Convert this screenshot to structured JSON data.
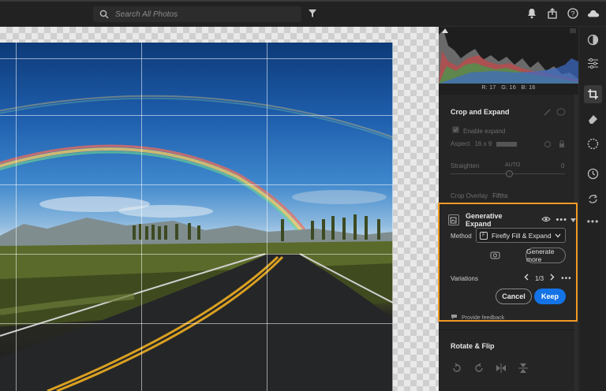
{
  "search": {
    "placeholder": "Search All Photos"
  },
  "histogram": {
    "r_label": "R:",
    "r_value": "17",
    "g_label": "G:",
    "g_value": "16",
    "b_label": "B:",
    "b_value": "16"
  },
  "crop": {
    "title": "Crop and Expand",
    "enable_label": "Enable expand",
    "aspect_label": "Aspect",
    "aspect_value": "16 x 9",
    "straighten_label": "Straighten",
    "straighten_auto": "AUTO",
    "straighten_value": "0",
    "overlay_label": "Crop Overlay",
    "overlay_value": "Fifths"
  },
  "generative_expand": {
    "title": "Generative Expand",
    "method_label": "Method",
    "method_value": "Firefly Fill & Expand",
    "generate_more": "Generate more",
    "variations_label": "Variations",
    "variations_value": "1/3",
    "cancel": "Cancel",
    "keep": "Keep",
    "feedback": "Provide feedback"
  },
  "rotate": {
    "title": "Rotate & Flip"
  },
  "colors": {
    "accent": "#1473e6",
    "highlight": "#f29a24"
  }
}
